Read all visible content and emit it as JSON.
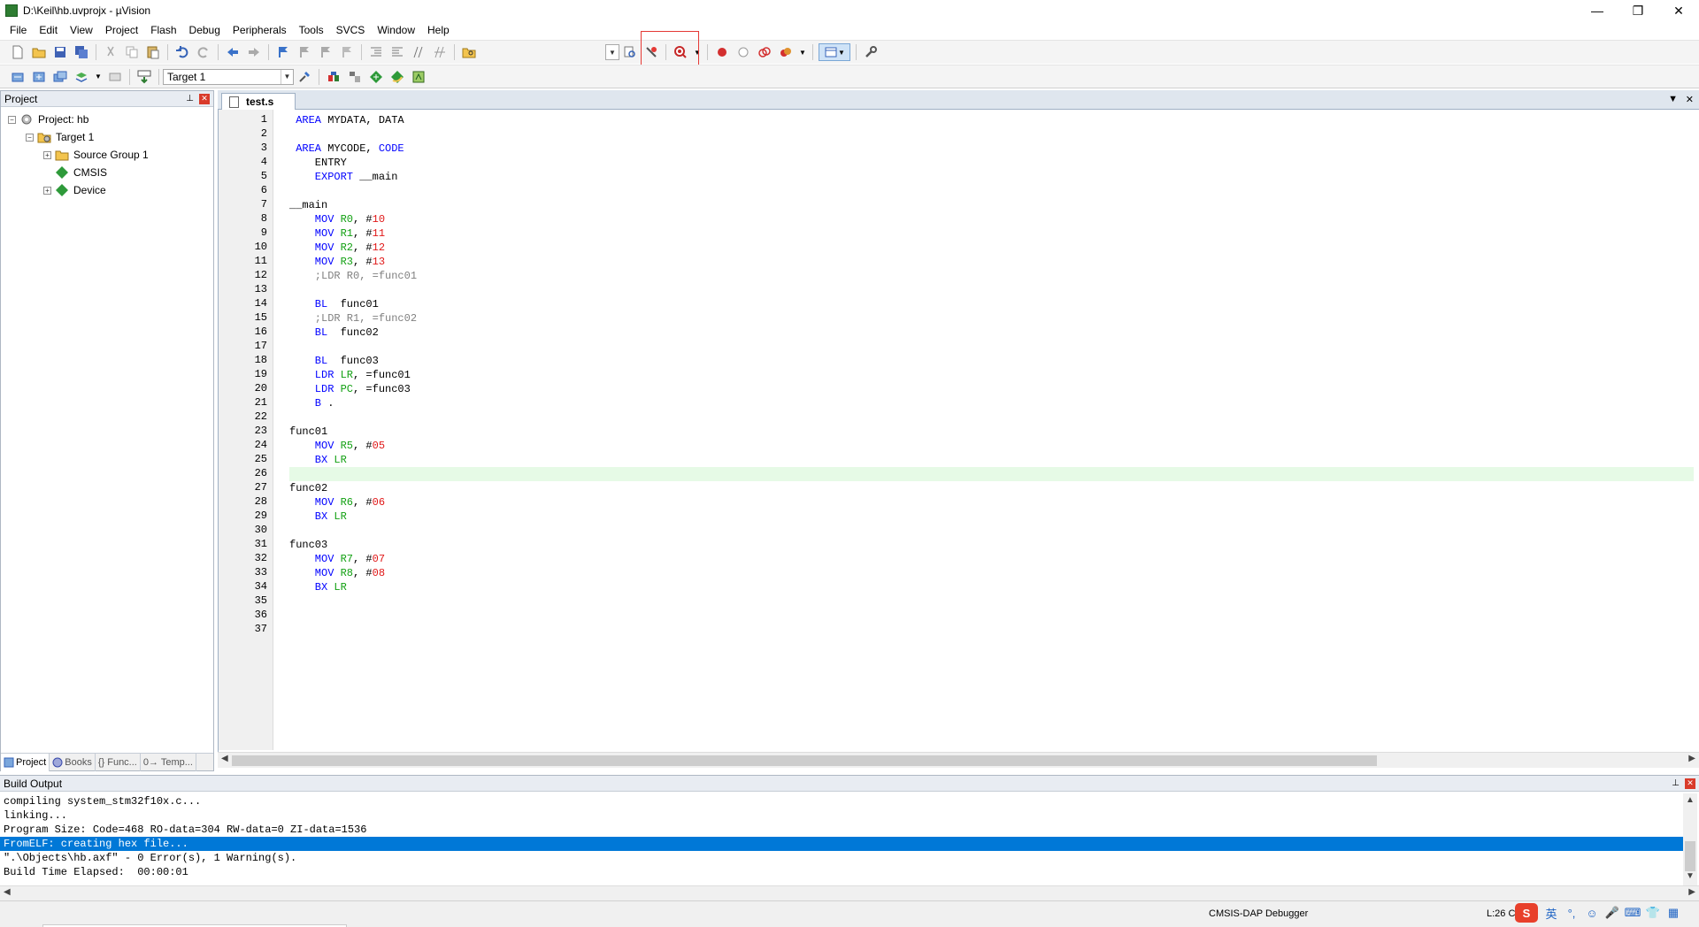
{
  "window": {
    "title": "D:\\Keil\\hb.uvprojx - µVision",
    "minimize": "—",
    "restore": "❐",
    "close": "✕"
  },
  "menu": [
    "File",
    "Edit",
    "View",
    "Project",
    "Flash",
    "Debug",
    "Peripherals",
    "Tools",
    "SVCS",
    "Window",
    "Help"
  ],
  "toolbar2": {
    "target_select": "Target 1"
  },
  "project_panel": {
    "title": "Project",
    "tree": {
      "project": "Project: hb",
      "target": "Target 1",
      "source_group": "Source Group 1",
      "cmsis": "CMSIS",
      "device": "Device"
    },
    "tabs": [
      "Project",
      "Books",
      "{} Func...",
      "0→ Temp..."
    ]
  },
  "editor": {
    "tab": "test.s",
    "lines": [
      {
        "n": "1",
        "parts": [
          [
            "kw",
            " AREA "
          ],
          [
            "",
            "MYDATA, DATA"
          ]
        ]
      },
      {
        "n": "2",
        "parts": []
      },
      {
        "n": "3",
        "parts": [
          [
            "kw",
            " AREA "
          ],
          [
            "",
            "MYCODE, "
          ],
          [
            "kw",
            "CODE"
          ]
        ]
      },
      {
        "n": "4",
        "parts": [
          [
            "",
            "    ENTRY"
          ]
        ]
      },
      {
        "n": "5",
        "parts": [
          [
            "kw",
            "    EXPORT "
          ],
          [
            "",
            "__main"
          ]
        ]
      },
      {
        "n": "6",
        "parts": []
      },
      {
        "n": "7",
        "parts": [
          [
            "",
            "__main"
          ]
        ]
      },
      {
        "n": "8",
        "parts": [
          [
            "kw",
            "    MOV "
          ],
          [
            "reg",
            "R0"
          ],
          [
            "",
            ", #"
          ],
          [
            "num",
            "10"
          ]
        ]
      },
      {
        "n": "9",
        "parts": [
          [
            "kw",
            "    MOV "
          ],
          [
            "reg",
            "R1"
          ],
          [
            "",
            ", #"
          ],
          [
            "num",
            "11"
          ]
        ]
      },
      {
        "n": "10",
        "parts": [
          [
            "kw",
            "    MOV "
          ],
          [
            "reg",
            "R2"
          ],
          [
            "",
            ", #"
          ],
          [
            "num",
            "12"
          ]
        ]
      },
      {
        "n": "11",
        "parts": [
          [
            "kw",
            "    MOV "
          ],
          [
            "reg",
            "R3"
          ],
          [
            "",
            ", #"
          ],
          [
            "num",
            "13"
          ]
        ]
      },
      {
        "n": "12",
        "parts": [
          [
            "cmt",
            "    ;LDR R0, =func01"
          ]
        ]
      },
      {
        "n": "13",
        "parts": []
      },
      {
        "n": "14",
        "parts": [
          [
            "kw",
            "    BL  "
          ],
          [
            "",
            "func01"
          ]
        ]
      },
      {
        "n": "15",
        "parts": [
          [
            "cmt",
            "    ;LDR R1, =func02"
          ]
        ]
      },
      {
        "n": "16",
        "parts": [
          [
            "kw",
            "    BL  "
          ],
          [
            "",
            "func02"
          ]
        ]
      },
      {
        "n": "17",
        "parts": []
      },
      {
        "n": "18",
        "parts": [
          [
            "kw",
            "    BL  "
          ],
          [
            "",
            "func03"
          ]
        ]
      },
      {
        "n": "19",
        "parts": [
          [
            "kw",
            "    LDR "
          ],
          [
            "reg",
            "LR"
          ],
          [
            "",
            ", =func01"
          ]
        ]
      },
      {
        "n": "20",
        "parts": [
          [
            "kw",
            "    LDR "
          ],
          [
            "reg",
            "PC"
          ],
          [
            "",
            ", =func03"
          ]
        ]
      },
      {
        "n": "21",
        "parts": [
          [
            "kw",
            "    B "
          ],
          [
            "",
            "."
          ]
        ]
      },
      {
        "n": "22",
        "parts": []
      },
      {
        "n": "23",
        "parts": [
          [
            "",
            "func01"
          ]
        ]
      },
      {
        "n": "24",
        "parts": [
          [
            "kw",
            "    MOV "
          ],
          [
            "reg",
            "R5"
          ],
          [
            "",
            ", #"
          ],
          [
            "num",
            "05"
          ]
        ]
      },
      {
        "n": "25",
        "parts": [
          [
            "kw",
            "    BX "
          ],
          [
            "reg",
            "LR"
          ]
        ]
      },
      {
        "n": "26",
        "parts": [],
        "current": true
      },
      {
        "n": "27",
        "parts": [
          [
            "",
            "func02"
          ]
        ]
      },
      {
        "n": "28",
        "parts": [
          [
            "kw",
            "    MOV "
          ],
          [
            "reg",
            "R6"
          ],
          [
            "",
            ", #"
          ],
          [
            "num",
            "06"
          ]
        ]
      },
      {
        "n": "29",
        "parts": [
          [
            "kw",
            "    BX "
          ],
          [
            "reg",
            "LR"
          ]
        ]
      },
      {
        "n": "30",
        "parts": []
      },
      {
        "n": "31",
        "parts": [
          [
            "",
            "func03"
          ]
        ]
      },
      {
        "n": "32",
        "parts": [
          [
            "kw",
            "    MOV "
          ],
          [
            "reg",
            "R7"
          ],
          [
            "",
            ", #"
          ],
          [
            "num",
            "07"
          ]
        ]
      },
      {
        "n": "33",
        "parts": [
          [
            "kw",
            "    MOV "
          ],
          [
            "reg",
            "R8"
          ],
          [
            "",
            ", #"
          ],
          [
            "num",
            "08"
          ]
        ]
      },
      {
        "n": "34",
        "parts": [
          [
            "kw",
            "    BX "
          ],
          [
            "reg",
            "LR"
          ]
        ]
      },
      {
        "n": "35",
        "parts": []
      },
      {
        "n": "36",
        "parts": []
      },
      {
        "n": "37",
        "parts": []
      }
    ]
  },
  "build_output": {
    "title": "Build Output",
    "lines": [
      "compiling system_stm32f10x.c...",
      "linking...",
      "Program Size: Code=468 RO-data=304 RW-data=0 ZI-data=1536",
      "FromELF: creating hex file...",
      "\".\\Objects\\hb.axf\" - 0 Error(s), 1 Warning(s).",
      "Build Time Elapsed:  00:00:01"
    ],
    "selected_index": 3
  },
  "status": {
    "debugger": "CMSIS-DAP Debugger",
    "position": "L:26 C:",
    "tray_ime": "英"
  },
  "colors": {
    "keyword": "#0000ff",
    "register": "#12a012",
    "number": "#e01818",
    "comment": "#808080",
    "current_line": "#e6fae6",
    "selection": "#0078d7",
    "highlight_box": "#e53935"
  }
}
